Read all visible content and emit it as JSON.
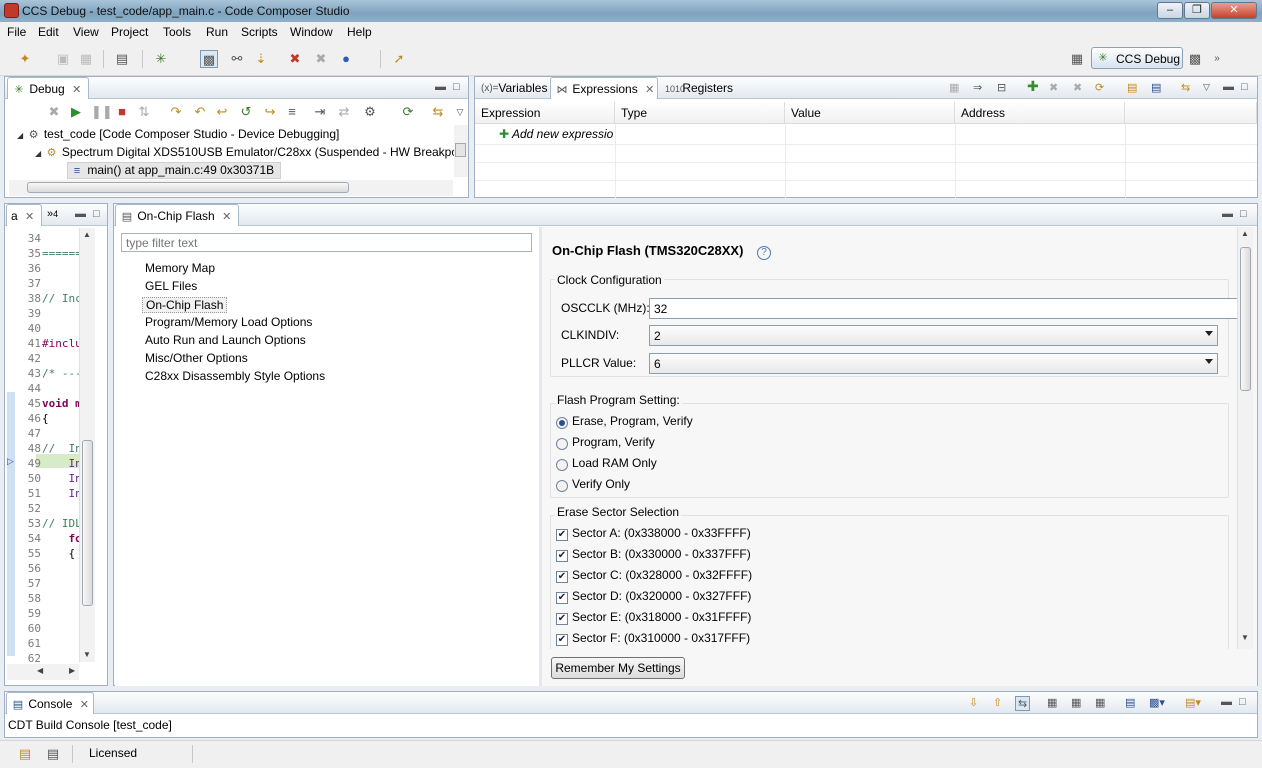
{
  "window": {
    "title": "CCS Debug - test_code/app_main.c - Code Composer Studio"
  },
  "menu": [
    "File",
    "Edit",
    "View",
    "Project",
    "Tools",
    "Run",
    "Scripts",
    "Window",
    "Help"
  ],
  "perspective": {
    "label": "CCS Debug"
  },
  "debug_view": {
    "tab": "Debug",
    "tree": [
      "test_code [Code Composer Studio - Device Debugging]",
      "Spectrum Digital XDS510USB Emulator/C28xx (Suspended - HW Breakpoi",
      "main() at app_main.c:49 0x30371B"
    ]
  },
  "expressions_view": {
    "tabs": [
      "Variables",
      "Expressions",
      "Registers"
    ],
    "columns": [
      "Expression",
      "Type",
      "Value",
      "Address"
    ],
    "add_row": "Add new expressio"
  },
  "editor": {
    "tab_short": "a",
    "overflow_count": "4",
    "lines": [
      {
        "n": "34",
        "t": ""
      },
      {
        "n": "35",
        "t": "======"
      },
      {
        "n": "36",
        "t": ""
      },
      {
        "n": "37",
        "t": ""
      },
      {
        "n": "38",
        "t": "// Inc"
      },
      {
        "n": "39",
        "t": ""
      },
      {
        "n": "40",
        "t": ""
      },
      {
        "n": "41",
        "t": "#inclu"
      },
      {
        "n": "42",
        "t": ""
      },
      {
        "n": "43",
        "t": "/* ---"
      },
      {
        "n": "44",
        "t": ""
      },
      {
        "n": "45",
        "t": "void m"
      },
      {
        "n": "46",
        "t": "{"
      },
      {
        "n": "47",
        "t": ""
      },
      {
        "n": "48",
        "t": "//  In"
      },
      {
        "n": "49",
        "t": "    In"
      },
      {
        "n": "50",
        "t": "    In"
      },
      {
        "n": "51",
        "t": "    In"
      },
      {
        "n": "52",
        "t": ""
      },
      {
        "n": "53",
        "t": "// IDL"
      },
      {
        "n": "54",
        "t": "    fo"
      },
      {
        "n": "55",
        "t": "    {"
      },
      {
        "n": "56",
        "t": ""
      },
      {
        "n": "57",
        "t": ""
      },
      {
        "n": "58",
        "t": ""
      },
      {
        "n": "59",
        "t": ""
      },
      {
        "n": "60",
        "t": ""
      },
      {
        "n": "61",
        "t": ""
      },
      {
        "n": "62",
        "t": ""
      }
    ]
  },
  "flash_view": {
    "tab": "On-Chip Flash",
    "filter_placeholder": "type filter text",
    "options": [
      "Memory Map",
      "GEL Files",
      "On-Chip Flash",
      "Program/Memory Load Options",
      "Auto Run and Launch Options",
      "Misc/Other Options",
      "C28xx Disassembly Style Options"
    ],
    "selected_option": "On-Chip Flash",
    "heading": "On-Chip Flash (TMS320C28XX)",
    "clock": {
      "group": "Clock Configuration",
      "oscclk_label": "OSCCLK (MHz):",
      "oscclk_value": "32",
      "clkindiv_label": "CLKINDIV:",
      "clkindiv_value": "2",
      "pllcr_label": "PLLCR Value:",
      "pllcr_value": "6"
    },
    "program": {
      "group": "Flash Program Setting:",
      "options": [
        "Erase, Program, Verify",
        "Program, Verify",
        "Load RAM Only",
        "Verify Only"
      ],
      "selected": 0
    },
    "sectors": {
      "group": "Erase Sector Selection",
      "items": [
        {
          "label": "Sector A: (0x338000 - 0x33FFFF)",
          "checked": true
        },
        {
          "label": "Sector B: (0x330000 - 0x337FFF)",
          "checked": true
        },
        {
          "label": "Sector C: (0x328000 - 0x32FFFF)",
          "checked": true
        },
        {
          "label": "Sector D: (0x320000 - 0x327FFF)",
          "checked": true
        },
        {
          "label": "Sector E: (0x318000 - 0x31FFFF)",
          "checked": true
        },
        {
          "label": "Sector F: (0x310000 - 0x317FFF)",
          "checked": true
        }
      ]
    },
    "remember_button": "Remember My Settings"
  },
  "console": {
    "tab": "Console",
    "text": "CDT Build Console [test_code]"
  },
  "status": {
    "text": "Licensed"
  },
  "colors": {
    "accent": "#2a4f8f",
    "current_line": "#d7ebc9"
  }
}
